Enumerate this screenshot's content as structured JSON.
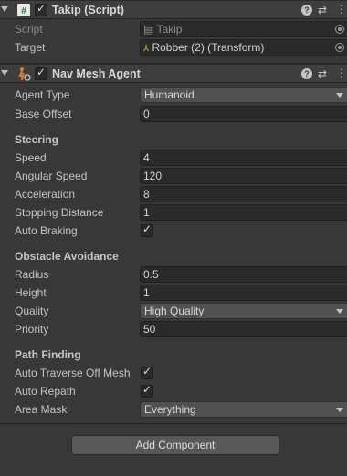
{
  "takip": {
    "title": "Takip (Script)",
    "script_label": "Script",
    "script_value": "Takip",
    "target_label": "Target",
    "target_value": "Robber (2) (Transform)",
    "enabled": "✓"
  },
  "navmesh": {
    "title": "Nav Mesh Agent",
    "enabled": "✓",
    "agent_type_label": "Agent Type",
    "agent_type_value": "Humanoid",
    "base_offset_label": "Base Offset",
    "base_offset_value": "0",
    "steering_header": "Steering",
    "speed_label": "Speed",
    "speed_value": "4",
    "angular_speed_label": "Angular Speed",
    "angular_speed_value": "120",
    "acceleration_label": "Acceleration",
    "acceleration_value": "8",
    "stopping_distance_label": "Stopping Distance",
    "stopping_distance_value": "1",
    "auto_braking_label": "Auto Braking",
    "auto_braking_value": "✓",
    "obstacle_header": "Obstacle Avoidance",
    "radius_label": "Radius",
    "radius_value": "0.5",
    "height_label": "Height",
    "height_value": "1",
    "quality_label": "Quality",
    "quality_value": "High Quality",
    "priority_label": "Priority",
    "priority_value": "50",
    "pathfinding_header": "Path Finding",
    "auto_traverse_label": "Auto Traverse Off Mesh",
    "auto_traverse_value": "✓",
    "auto_repath_label": "Auto Repath",
    "auto_repath_value": "✓",
    "area_mask_label": "Area Mask",
    "area_mask_value": "Everything"
  },
  "header_buttons": {
    "help": "?",
    "presets": "⇄",
    "more": "⋮"
  },
  "add_component_label": "Add Component"
}
